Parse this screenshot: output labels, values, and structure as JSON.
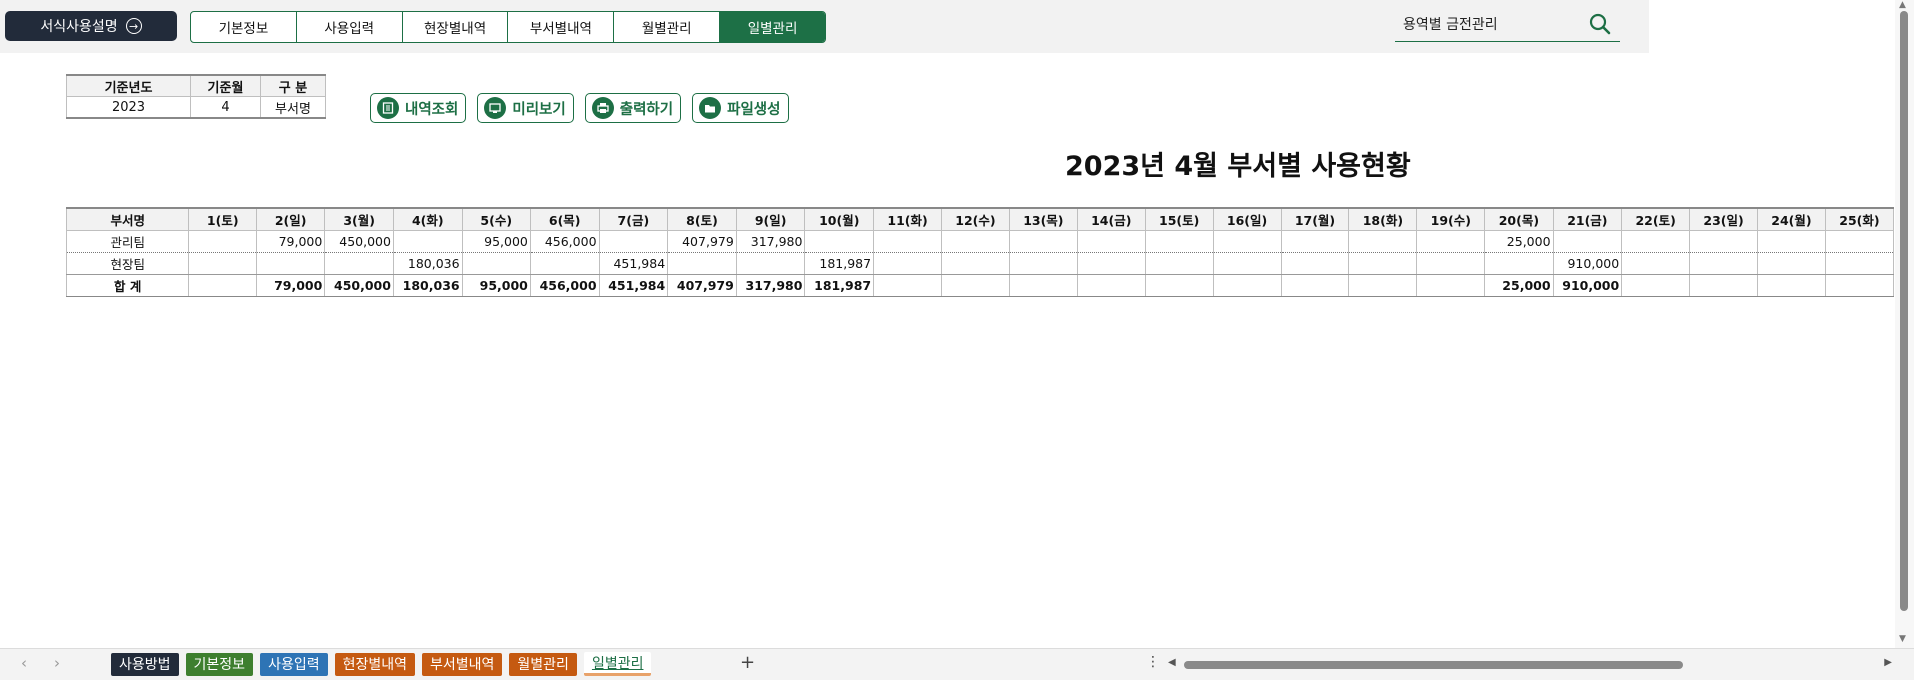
{
  "topbar": {
    "guide_label": "서식사용설명",
    "nav_tabs": [
      "기본정보",
      "사용입력",
      "현장별내역",
      "부서별내역",
      "월별관리",
      "일별관리"
    ],
    "active_tab": "일별관리",
    "search_text": "용역별 금전관리"
  },
  "info": {
    "headers": [
      "기준년도",
      "기준월",
      "구 분"
    ],
    "values": [
      "2023",
      "4",
      "부서명"
    ]
  },
  "actions": [
    {
      "label": "내역조회",
      "icon": "list-icon"
    },
    {
      "label": "미리보기",
      "icon": "preview-icon"
    },
    {
      "label": "출력하기",
      "icon": "printer-icon"
    },
    {
      "label": "파일생성",
      "icon": "folder-icon"
    }
  ],
  "report": {
    "title": "2023년 4월 부서별 사용현황",
    "columns": [
      "부서명",
      "1(토)",
      "2(일)",
      "3(월)",
      "4(화)",
      "5(수)",
      "6(목)",
      "7(금)",
      "8(토)",
      "9(일)",
      "10(월)",
      "11(화)",
      "12(수)",
      "13(목)",
      "14(금)",
      "15(토)",
      "16(일)",
      "17(월)",
      "18(화)",
      "19(수)",
      "20(목)",
      "21(금)",
      "22(토)",
      "23(일)",
      "24(월)",
      "25(화)"
    ],
    "rows": [
      {
        "name": "관리팀",
        "values": [
          "",
          "79,000",
          "450,000",
          "",
          "95,000",
          "456,000",
          "",
          "407,979",
          "317,980",
          "",
          "",
          "",
          "",
          "",
          "",
          "",
          "",
          "",
          "",
          "25,000",
          "",
          "",
          "",
          "",
          ""
        ]
      },
      {
        "name": "현장팀",
        "values": [
          "",
          "",
          "",
          "180,036",
          "",
          "",
          "451,984",
          "",
          "",
          "181,987",
          "",
          "",
          "",
          "",
          "",
          "",
          "",
          "",
          "",
          "",
          "910,000",
          "",
          "",
          "",
          ""
        ]
      }
    ],
    "total": {
      "name": "합 계",
      "values": [
        "",
        "79,000",
        "450,000",
        "180,036",
        "95,000",
        "456,000",
        "451,984",
        "407,979",
        "317,980",
        "181,987",
        "",
        "",
        "",
        "",
        "",
        "",
        "",
        "",
        "",
        "25,000",
        "910,000",
        "",
        "",
        "",
        ""
      ]
    }
  },
  "sheet_tabs": [
    {
      "label": "사용방법",
      "color": "#222b3a"
    },
    {
      "label": "기본정보",
      "color": "#3e7f2f"
    },
    {
      "label": "사용입력",
      "color": "#2e74b5"
    },
    {
      "label": "현장별내역",
      "color": "#c55a11"
    },
    {
      "label": "부서별내역",
      "color": "#c55a11"
    },
    {
      "label": "월별관리",
      "color": "#c55a11"
    },
    {
      "label": "일별관리",
      "color": "#ffffff"
    }
  ],
  "active_sheet": "일별관리",
  "colors": {
    "accent": "#1d6f45",
    "dark": "#222b3a"
  }
}
